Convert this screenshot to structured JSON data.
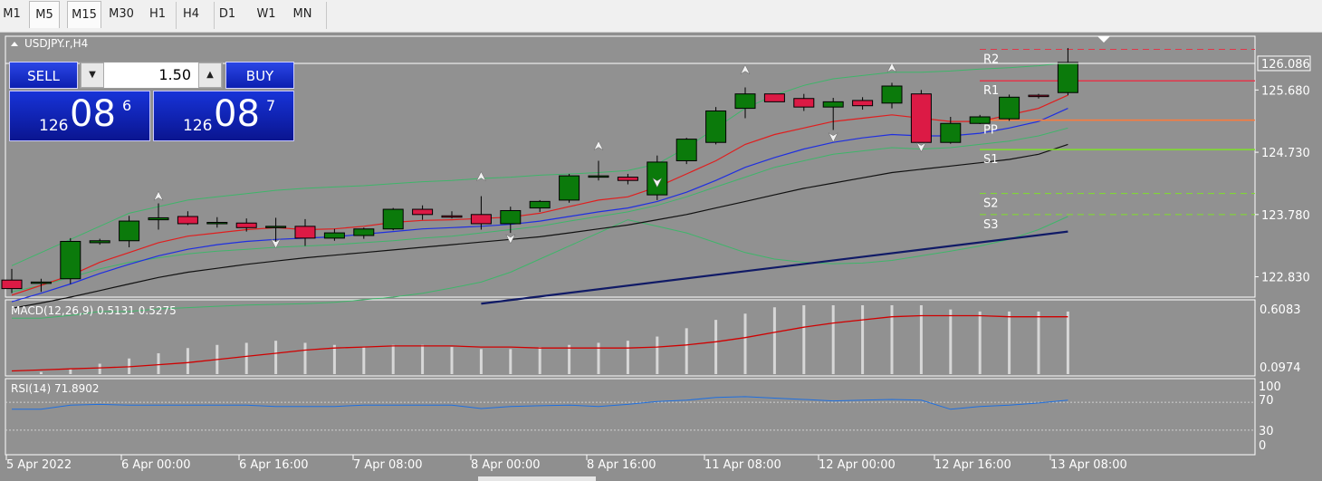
{
  "timeframes": [
    "M1",
    "M5",
    "M15",
    "M30",
    "H1",
    "H4",
    "D1",
    "W1",
    "MN"
  ],
  "selected_timeframes": [
    "M5",
    "M15"
  ],
  "chart": {
    "symbol_label": "USDJPY.r,H4",
    "current_price": "126.086",
    "price_ticks": [
      "125.680",
      "124.730",
      "123.780",
      "122.830"
    ],
    "time_labels": [
      "5 Apr 2022",
      "6 Apr 00:00",
      "6 Apr 16:00",
      "7 Apr 08:00",
      "8 Apr 00:00",
      "8 Apr 16:00",
      "11 Apr 08:00",
      "12 Apr 00:00",
      "12 Apr 16:00",
      "13 Apr 08:00"
    ],
    "pivots": [
      {
        "label": "R2",
        "color": "#e2364a",
        "price": 126.3,
        "dash": true
      },
      {
        "label": "R1",
        "color": "#e2364a",
        "price": 125.82,
        "dash": false
      },
      {
        "label": "PP",
        "color": "#ff7a3a",
        "price": 125.22,
        "dash": false
      },
      {
        "label": "S1",
        "color": "#7fe02a",
        "price": 124.77,
        "dash": false
      },
      {
        "label": "S2",
        "color": "#7fe02a",
        "price": 124.1,
        "dash": true
      },
      {
        "label": "S3",
        "color": "#7fe02a",
        "price": 123.78,
        "dash": true
      }
    ],
    "candles": [
      [
        122.78,
        122.95,
        122.58,
        122.65
      ],
      [
        122.73,
        122.8,
        122.6,
        122.75
      ],
      [
        122.8,
        123.42,
        122.72,
        123.37
      ],
      [
        123.35,
        123.41,
        123.32,
        123.38
      ],
      [
        123.38,
        123.76,
        123.28,
        123.68
      ],
      [
        123.7,
        123.95,
        123.55,
        123.73
      ],
      [
        123.75,
        123.83,
        123.62,
        123.64
      ],
      [
        123.65,
        123.74,
        123.58,
        123.66
      ],
      [
        123.65,
        123.72,
        123.52,
        123.58
      ],
      [
        123.6,
        123.73,
        123.3,
        123.6
      ],
      [
        123.6,
        123.71,
        123.3,
        123.42
      ],
      [
        123.42,
        123.56,
        123.38,
        123.5
      ],
      [
        123.46,
        123.58,
        123.41,
        123.56
      ],
      [
        123.56,
        123.88,
        123.54,
        123.86
      ],
      [
        123.86,
        123.92,
        123.7,
        123.78
      ],
      [
        123.76,
        123.83,
        123.72,
        123.75
      ],
      [
        123.78,
        124.06,
        123.55,
        123.64
      ],
      [
        123.64,
        123.9,
        123.5,
        123.84
      ],
      [
        123.88,
        124.0,
        123.82,
        123.98
      ],
      [
        124.0,
        124.4,
        123.96,
        124.37
      ],
      [
        124.37,
        124.6,
        124.3,
        124.37
      ],
      [
        124.35,
        124.4,
        124.24,
        124.3
      ],
      [
        124.08,
        124.68,
        124.0,
        124.58
      ],
      [
        124.6,
        124.95,
        124.55,
        124.93
      ],
      [
        124.88,
        125.42,
        124.85,
        125.36
      ],
      [
        125.4,
        125.72,
        125.25,
        125.62
      ],
      [
        125.62,
        125.6,
        125.5,
        125.5
      ],
      [
        125.55,
        125.62,
        125.36,
        125.42
      ],
      [
        125.42,
        125.56,
        125.07,
        125.5
      ],
      [
        125.52,
        125.57,
        125.38,
        125.44
      ],
      [
        125.48,
        125.79,
        125.4,
        125.74
      ],
      [
        125.62,
        125.68,
        124.92,
        124.88
      ],
      [
        124.88,
        125.27,
        124.86,
        125.17
      ],
      [
        125.17,
        125.3,
        125.16,
        125.27
      ],
      [
        125.24,
        125.61,
        125.21,
        125.57
      ],
      [
        125.6,
        125.62,
        125.55,
        125.58
      ],
      [
        125.64,
        126.32,
        125.6,
        126.1
      ]
    ],
    "ema_red": [
      122.55,
      122.7,
      122.85,
      123.05,
      123.2,
      123.35,
      123.45,
      123.5,
      123.55,
      123.58,
      123.55,
      123.56,
      123.6,
      123.66,
      123.69,
      123.7,
      123.72,
      123.74,
      123.8,
      123.9,
      124.0,
      124.05,
      124.2,
      124.4,
      124.6,
      124.85,
      125.0,
      125.1,
      125.2,
      125.25,
      125.3,
      125.25,
      125.2,
      125.2,
      125.3,
      125.4,
      125.6
    ],
    "ema_blue": [
      122.45,
      122.58,
      122.72,
      122.88,
      123.02,
      123.15,
      123.25,
      123.32,
      123.37,
      123.4,
      123.42,
      123.44,
      123.48,
      123.52,
      123.56,
      123.58,
      123.6,
      123.63,
      123.68,
      123.75,
      123.82,
      123.88,
      123.98,
      124.12,
      124.3,
      124.5,
      124.65,
      124.78,
      124.88,
      124.95,
      125.0,
      124.98,
      124.98,
      125.02,
      125.1,
      125.2,
      125.4
    ],
    "ema_black": [
      122.35,
      122.43,
      122.52,
      122.62,
      122.72,
      122.82,
      122.9,
      122.96,
      123.02,
      123.07,
      123.12,
      123.16,
      123.2,
      123.24,
      123.28,
      123.32,
      123.36,
      123.4,
      123.44,
      123.5,
      123.56,
      123.62,
      123.7,
      123.78,
      123.88,
      123.98,
      124.08,
      124.18,
      124.26,
      124.34,
      124.42,
      124.47,
      124.52,
      124.57,
      124.62,
      124.7,
      124.85
    ],
    "bb_upper": [
      123.0,
      123.2,
      123.4,
      123.6,
      123.8,
      123.9,
      124.0,
      124.05,
      124.1,
      124.15,
      124.18,
      124.2,
      124.22,
      124.25,
      124.28,
      124.3,
      124.33,
      124.35,
      124.38,
      124.4,
      124.42,
      124.45,
      124.55,
      124.8,
      125.1,
      125.4,
      125.6,
      125.75,
      125.85,
      125.9,
      125.95,
      125.95,
      125.97,
      126.0,
      126.02,
      126.05,
      126.1
    ],
    "bb_mid": [
      122.6,
      122.7,
      122.82,
      122.95,
      123.05,
      123.12,
      123.18,
      123.22,
      123.25,
      123.28,
      123.3,
      123.32,
      123.35,
      123.38,
      123.42,
      123.45,
      123.5,
      123.55,
      123.6,
      123.68,
      123.75,
      123.82,
      123.92,
      124.05,
      124.2,
      124.35,
      124.5,
      124.6,
      124.7,
      124.75,
      124.8,
      124.78,
      124.8,
      124.85,
      124.9,
      124.98,
      125.1
    ],
    "bb_lower": [
      122.2,
      122.2,
      122.24,
      122.3,
      122.3,
      122.34,
      122.36,
      122.38,
      122.4,
      122.41,
      122.42,
      122.44,
      122.48,
      122.52,
      122.58,
      122.66,
      122.75,
      122.9,
      123.1,
      123.3,
      123.5,
      123.7,
      123.6,
      123.5,
      123.35,
      123.2,
      123.1,
      123.05,
      123.03,
      123.04,
      123.08,
      123.15,
      123.22,
      123.3,
      123.4,
      123.55,
      123.75
    ],
    "trend_navy": {
      "from": [
        16,
        122.42
      ],
      "to": [
        36,
        123.52
      ]
    },
    "arrows": [
      [
        5,
        124.05,
        "up"
      ],
      [
        9,
        123.35,
        "down"
      ],
      [
        16,
        124.35,
        "up"
      ],
      [
        17,
        123.42,
        "down"
      ],
      [
        20,
        124.82,
        "up"
      ],
      [
        22,
        124.28,
        "down"
      ],
      [
        25,
        125.98,
        "up"
      ],
      [
        28,
        124.97,
        "down"
      ],
      [
        30,
        126.01,
        "up"
      ],
      [
        31,
        124.82,
        "down"
      ]
    ],
    "macd": {
      "label": "MACD(12,26,9) 0.5131 0.5275",
      "ticks": [
        "0.6083",
        "0.0974"
      ],
      "bars": [
        0.0,
        0.02,
        0.05,
        0.1,
        0.15,
        0.2,
        0.25,
        0.28,
        0.3,
        0.32,
        0.3,
        0.28,
        0.26,
        0.28,
        0.28,
        0.26,
        0.24,
        0.24,
        0.26,
        0.28,
        0.3,
        0.32,
        0.36,
        0.44,
        0.52,
        0.58,
        0.64,
        0.66,
        0.66,
        0.66,
        0.66,
        0.66,
        0.62,
        0.6,
        0.6,
        0.6,
        0.6
      ],
      "signal": [
        0.03,
        0.04,
        0.05,
        0.06,
        0.07,
        0.09,
        0.11,
        0.14,
        0.17,
        0.2,
        0.23,
        0.25,
        0.26,
        0.27,
        0.27,
        0.27,
        0.26,
        0.26,
        0.25,
        0.25,
        0.25,
        0.25,
        0.26,
        0.28,
        0.31,
        0.35,
        0.4,
        0.45,
        0.49,
        0.52,
        0.55,
        0.56,
        0.56,
        0.56,
        0.55,
        0.55,
        0.55
      ]
    },
    "rsi": {
      "label": "RSI(14) 71.8902",
      "ticks": [
        "100",
        "70",
        "30",
        "0"
      ],
      "values": [
        60,
        60,
        66,
        67,
        66,
        66,
        66,
        66,
        66,
        64,
        64,
        64,
        66,
        66,
        66,
        66,
        61,
        64,
        65,
        66,
        64,
        67,
        71,
        73,
        77,
        78,
        76,
        74,
        72,
        73,
        74,
        73,
        60,
        64,
        66,
        69,
        73
      ]
    }
  },
  "trade_panel": {
    "sell_label": "SELL",
    "buy_label": "BUY",
    "lot": "1.50",
    "bid": {
      "a": "126",
      "b": "08",
      "c": "6"
    },
    "ask": {
      "a": "126",
      "b": "08",
      "c": "7"
    }
  }
}
